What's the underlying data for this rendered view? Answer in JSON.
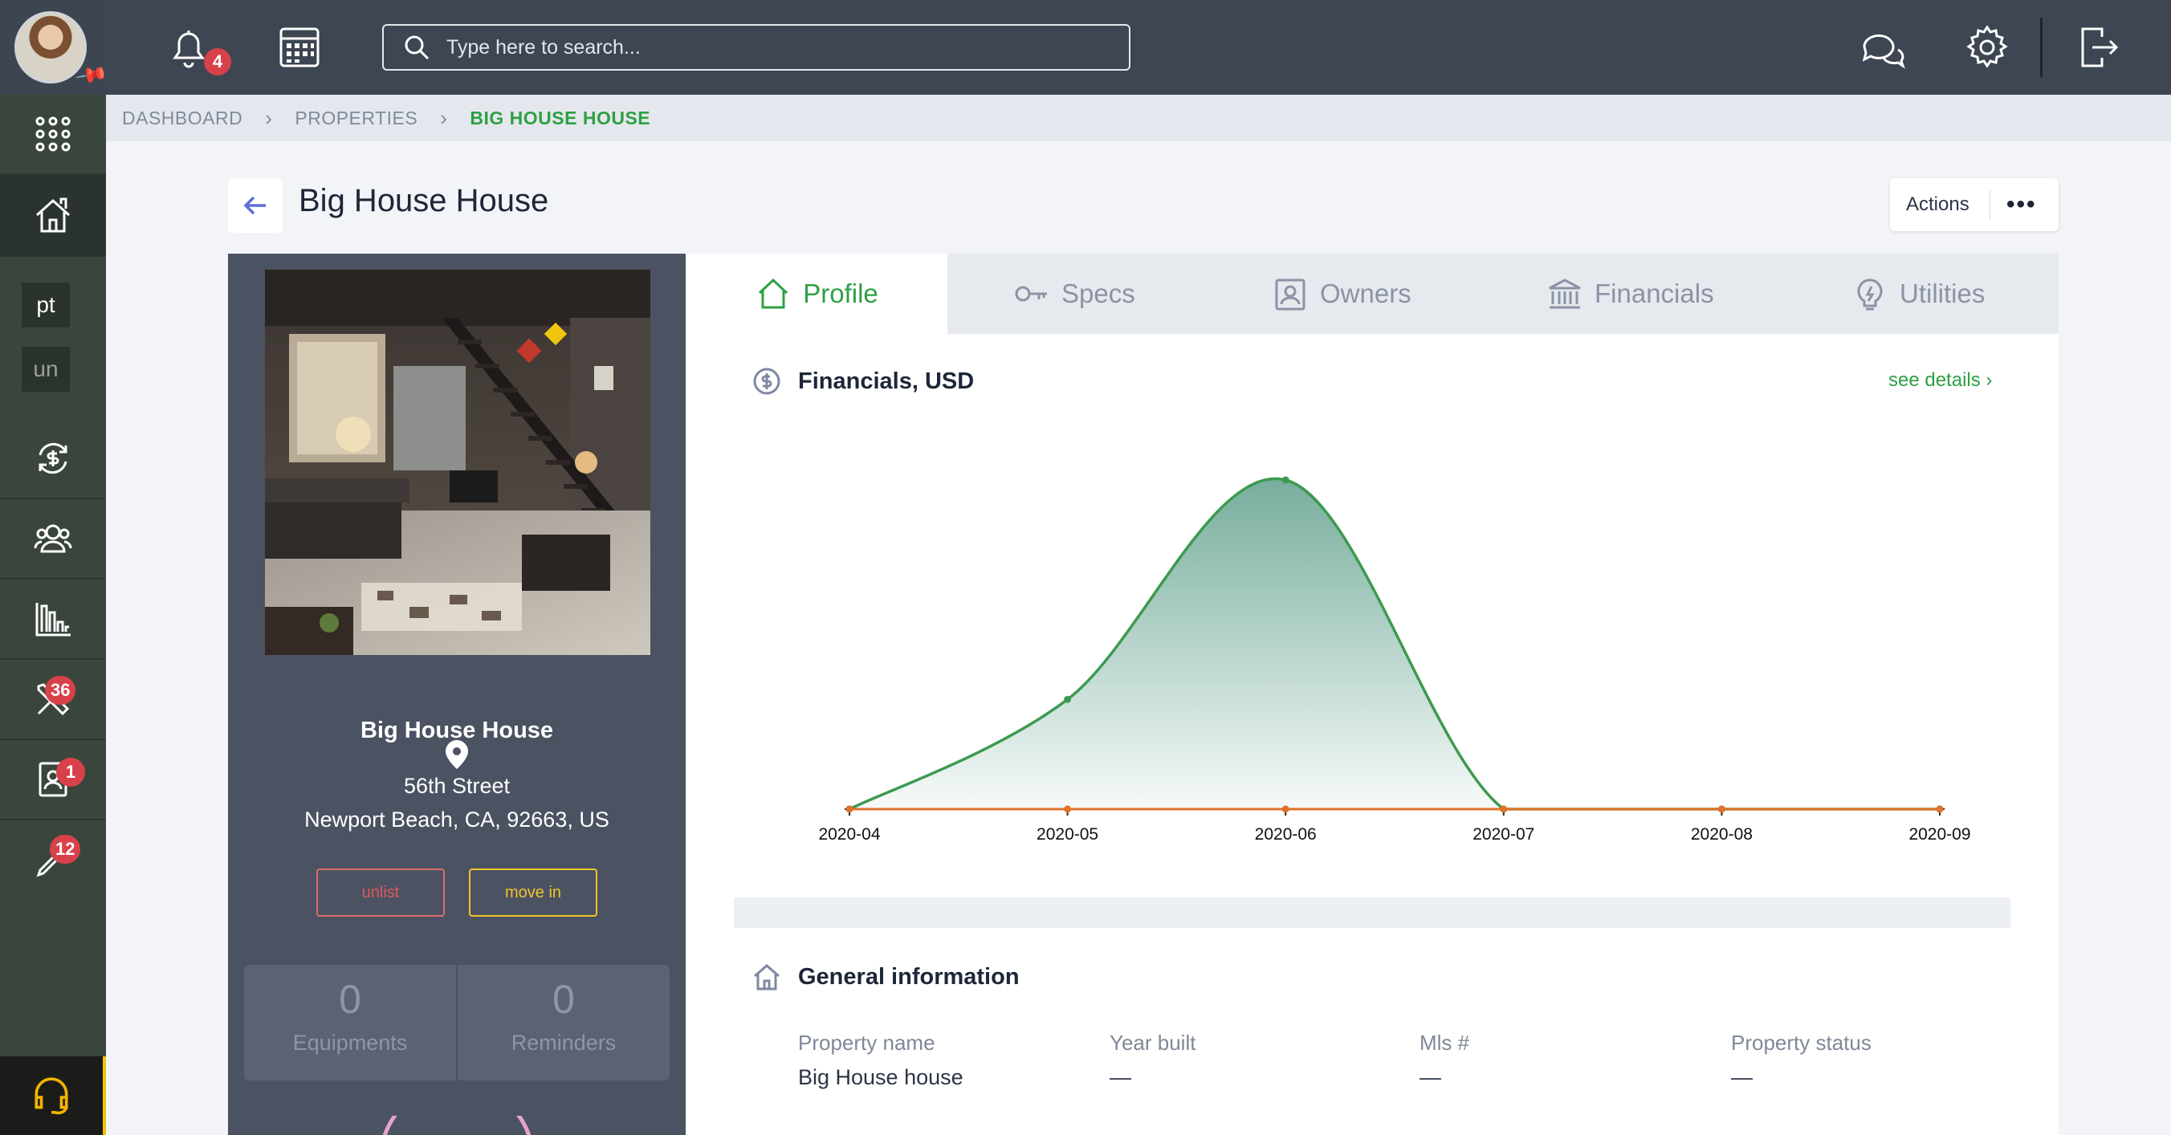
{
  "topbar": {
    "notifications_count": "4",
    "search_placeholder": "Type here to search..."
  },
  "sidebar": {
    "tag_pt": "pt",
    "tag_un": "un",
    "maintenance_count": "36",
    "tenants_count": "1",
    "tools_count": "12"
  },
  "breadcrumb": {
    "items": [
      "DASHBOARD",
      "PROPERTIES",
      "BIG HOUSE HOUSE"
    ]
  },
  "page": {
    "title": "Big House House",
    "actions_label": "Actions",
    "actions_more": "•••"
  },
  "property": {
    "name": "Big House House",
    "address_line1": "56th Street",
    "address_line2": "Newport Beach, CA, 92663, US",
    "unlist_label": "unlist",
    "move_in_label": "move in",
    "equipments_count": "0",
    "equipments_label": "Equipments",
    "reminders_count": "0",
    "reminders_label": "Reminders"
  },
  "tabs": [
    "Profile",
    "Specs",
    "Owners",
    "Financials",
    "Utilities"
  ],
  "financials": {
    "title": "Financials, USD",
    "see_details": "see details"
  },
  "chart_data": {
    "type": "area",
    "x": [
      "2020-04",
      "2020-05",
      "2020-06",
      "2020-07",
      "2020-08",
      "2020-09"
    ],
    "series": [
      {
        "values": [
          0,
          1,
          3,
          0,
          0,
          0
        ],
        "color": "#3c9a50"
      },
      {
        "values": [
          0,
          0,
          0,
          0,
          0,
          0
        ],
        "color": "#e0722a"
      }
    ],
    "title": "Financials, USD",
    "grid": false
  },
  "general_info": {
    "title": "General information",
    "fields": [
      {
        "label": "Property name",
        "value": "Big House house"
      },
      {
        "label": "Year built",
        "value": "—"
      },
      {
        "label": "Mls #",
        "value": "—"
      },
      {
        "label": "Property status",
        "value": "—"
      }
    ]
  },
  "colors": {
    "accent_green": "#2ea043",
    "badge_red": "#d9414a",
    "topbar": "#3d4652",
    "sidebar": "#3a463c"
  }
}
